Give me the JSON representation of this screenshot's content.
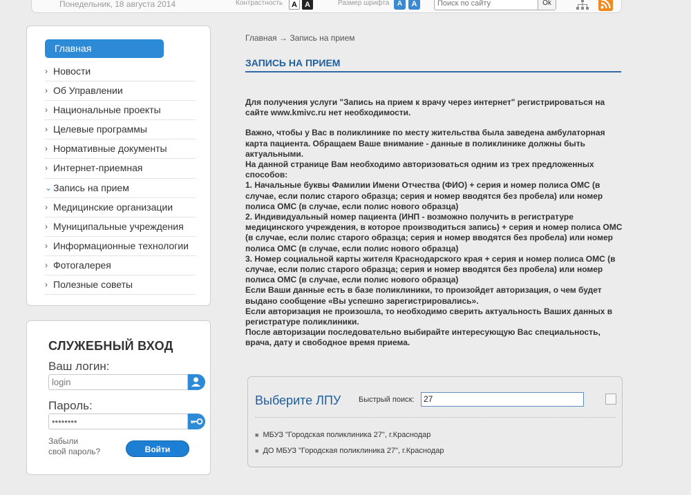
{
  "header": {
    "date": "Понедельник, 18 августа 2014",
    "contrast_label": "Контрастность",
    "contrast_light": "A",
    "contrast_dark": "A",
    "font_label": "Размер шрифта",
    "font_small": "A",
    "font_large": "A",
    "search_placeholder": "Поиск по сайту",
    "search_button": "Ok",
    "icons": [
      "sitemap-icon",
      "rss-icon"
    ]
  },
  "menu": {
    "home": "Главная",
    "items": [
      "Новости",
      "Об Управлении",
      "Национальные проекты",
      "Целевые программы",
      "Нормативные документы",
      "Интернет-приемная",
      "Запись на прием",
      "Медицинские организации",
      "Муниципальные учреждения",
      "Информационные технологии",
      "Фотогалерея",
      "Полезные советы"
    ],
    "arrow_closed": "›",
    "arrow_open": "⌄"
  },
  "login": {
    "title": "СЛУЖЕБНЫЙ ВХОД",
    "login_label": "Ваш логин:",
    "login_value": "login",
    "password_label": "Пароль:",
    "password_value": "••••••••",
    "forgot": [
      "Забыли",
      "свой пароль?"
    ],
    "submit": "Войти"
  },
  "breadcrumb": {
    "home": "Главная",
    "separator": "→",
    "current": "Запись на прием"
  },
  "page": {
    "title": "ЗАПИСЬ НА ПРИЕМ",
    "paragraphs": [
      "Для получения услуги \"Запись на прием к врачу через интернет\" регистрироваться на сайте www.kmivc.ru нет необходимости.",
      "Важно, чтобы у Вас в поликлинике по месту жительства была заведена амбулаторная карта пациента. Обращаем Ваше внимание - данные в поликлинике должны быть актуальными.",
      "На данной странице Вам необходимо авторизоваться одним из трех предложенных способов:",
      "1. Начальные буквы Фамилии Имени Отчества (ФИО) + серия и номер полиса ОМС (в случае, если полис старого образца; серия и номер вводятся без пробела) или номер полиса ОМС (в случае, если полис нового образца)",
      "2. Индивидуальный номер пациента (ИНП - возможно получить в регистратуре медицинского учреждения, в которое производиться запись) + серия и номер полиса ОМС (в случае, если полис старого образца; серия и номер вводятся без пробела) или номер полиса ОМС (в случае, если полис нового образца)",
      "3. Номер социальной карты жителя Краснодарского края + серия и номер полиса ОМС (в случае, если полис старого образца; серия и номер вводятся без пробела) или номер полиса ОМС (в случае, если полис нового образца)",
      "Если Ваши данные есть в базе поликлиники, то произойдет авторизация, о чем будет выдано сообщение «Вы успешно зарегистрировались».",
      "Если авторизация не произошла, то необходимо сверить актуальность Ваших данных в регистратуре поликлиники.",
      "После авторизации последовательно выбирайте интересующую Вас специальность, врача, дату и свободное время приема."
    ]
  },
  "lpu": {
    "title": "Выберите ЛПУ",
    "quick_label": "Быстрый поиск:",
    "quick_value": "27",
    "results": [
      "МБУЗ \"Городская поликлиника 27\", г.Краснодар",
      "ДО МБУЗ \"Городская поликлиника 27\", г.Краснодар"
    ]
  }
}
